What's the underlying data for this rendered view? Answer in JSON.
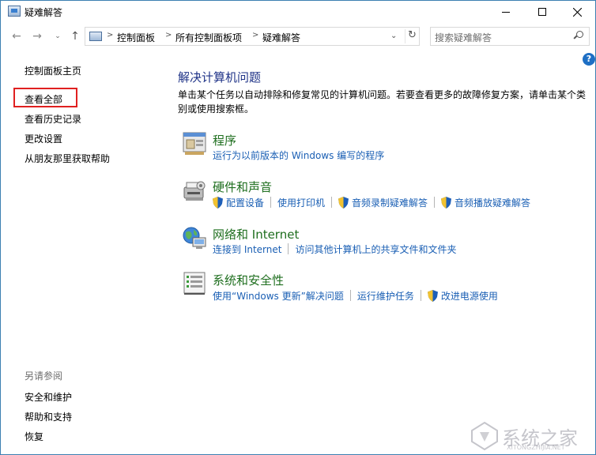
{
  "window": {
    "title": "疑难解答"
  },
  "nav": {
    "back_glyph": "←",
    "forward_glyph": "→",
    "dropdown_glyph": "⌄",
    "up_glyph": "↑",
    "breadcrumbs": [
      "控制面板",
      "所有控制面板项",
      "疑难解答"
    ],
    "crumb_separator": ">",
    "refresh_glyph": "↻",
    "search_placeholder": "搜索疑难解答"
  },
  "help": {
    "glyph": "?"
  },
  "sidebar": {
    "items": [
      "控制面板主页",
      "查看全部",
      "查看历史记录",
      "更改设置",
      "从朋友那里获取帮助"
    ],
    "see_also_heading": "另请参阅",
    "see_also_items": [
      "安全和维护",
      "帮助和支持",
      "恢复"
    ]
  },
  "main": {
    "title": "解决计算机问题",
    "description": "单击某个任务以自动排除和修复常见的计算机问题。若要查看更多的故障修复方案，请单击某个类别或使用搜索框。",
    "categories": [
      {
        "title": "程序",
        "icon": "programs-icon",
        "links": [
          {
            "label": "运行为以前版本的 Windows 编写的程序",
            "shield": false
          }
        ]
      },
      {
        "title": "硬件和声音",
        "icon": "hardware-sound-icon",
        "links": [
          {
            "label": "配置设备",
            "shield": true
          },
          {
            "label": "使用打印机",
            "shield": false
          },
          {
            "label": "音频录制疑难解答",
            "shield": true
          },
          {
            "label": "音频播放疑难解答",
            "shield": true
          }
        ]
      },
      {
        "title": "网络和 Internet",
        "icon": "network-icon",
        "links": [
          {
            "label": "连接到 Internet",
            "shield": false
          },
          {
            "label": "访问其他计算机上的共享文件和文件夹",
            "shield": false
          }
        ]
      },
      {
        "title": "系统和安全性",
        "icon": "system-security-icon",
        "links": [
          {
            "label": "使用“Windows 更新”解决问题",
            "shield": false
          },
          {
            "label": "运行维护任务",
            "shield": false
          },
          {
            "label": "改进电源使用",
            "shield": true
          }
        ]
      }
    ]
  },
  "watermark": {
    "text": "系统之家",
    "sub": "XITONGZHIJIA.NET"
  },
  "colors": {
    "link": "#1a5fb4",
    "category_title": "#1e6e1e",
    "main_title": "#1e3287",
    "highlight": "#e02020"
  }
}
